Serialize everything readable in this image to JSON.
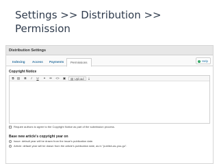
{
  "slide": {
    "title": "Settings  >>  Distribution  >>  Permission"
  },
  "panel": {
    "header": "Distribution Settings",
    "tabs": [
      {
        "label": "Indexing"
      },
      {
        "label": "Access"
      },
      {
        "label": "Payments"
      },
      {
        "label": "Permissions"
      }
    ],
    "help_label": "Help"
  },
  "copyright": {
    "label": "Copyright Notice",
    "toolbar": {
      "upload_label": "Upload"
    },
    "require_agree": "Require authors to agree to the Copyright Notice as part of the submission process."
  },
  "year_basis": {
    "label": "Base new article's copyright year on",
    "options": [
      {
        "label": "Issue: default year will be drawn from the issue's publication date."
      },
      {
        "label": "Article: default year will be drawn from the article's publication date, as in \"publish-as-you-go\"."
      }
    ]
  },
  "colors": {
    "tab_link": "#2a6f9e",
    "help_icon": "#1f9d55"
  }
}
